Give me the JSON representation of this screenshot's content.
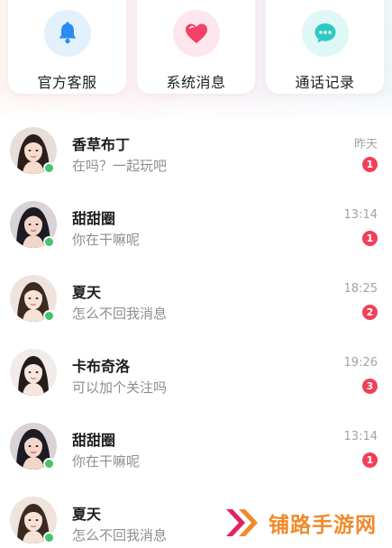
{
  "quick_actions": [
    {
      "label": "官方客服",
      "icon": "bell-icon",
      "color": "#2a8cf0"
    },
    {
      "label": "系统消息",
      "icon": "heart-icon",
      "color": "#f5406a"
    },
    {
      "label": "通话记录",
      "icon": "chat-bubble-icon",
      "color": "#2fc9c4"
    }
  ],
  "chats": [
    {
      "name": "香草布丁",
      "preview": "在吗？一起玩吧",
      "time": "昨天",
      "unread": "1",
      "online": true,
      "avatar": "female-avatar",
      "hair": "#2a1f1c",
      "skin": "#f6dccd"
    },
    {
      "name": "甜甜圈",
      "preview": "你在干嘛呢",
      "time": "13:14",
      "unread": "1",
      "online": true,
      "avatar": "female-avatar",
      "hair": "#1c1a22",
      "skin": "#f2d6c8"
    },
    {
      "name": "夏天",
      "preview": "怎么不回我消息",
      "time": "18:25",
      "unread": "2",
      "online": true,
      "avatar": "female-avatar",
      "hair": "#3a2a22",
      "skin": "#f7e2d6"
    },
    {
      "name": "卡布奇洛",
      "preview": "可以加个关注吗",
      "time": "19:26",
      "unread": "3",
      "online": false,
      "avatar": "female-avatar",
      "hair": "#231c1a",
      "skin": "#f8e6de"
    },
    {
      "name": "甜甜圈",
      "preview": "你在干嘛呢",
      "time": "13:14",
      "unread": "1",
      "online": true,
      "avatar": "female-avatar",
      "hair": "#1c1a22",
      "skin": "#f2d6c8"
    },
    {
      "name": "夏天",
      "preview": "怎么不回我消息",
      "time": "",
      "unread": "",
      "online": true,
      "avatar": "female-avatar",
      "hair": "#3a2a22",
      "skin": "#f7e2d6"
    }
  ],
  "watermark": {
    "text": "铺路手游网",
    "icon": "double-chevron-logo-icon"
  }
}
